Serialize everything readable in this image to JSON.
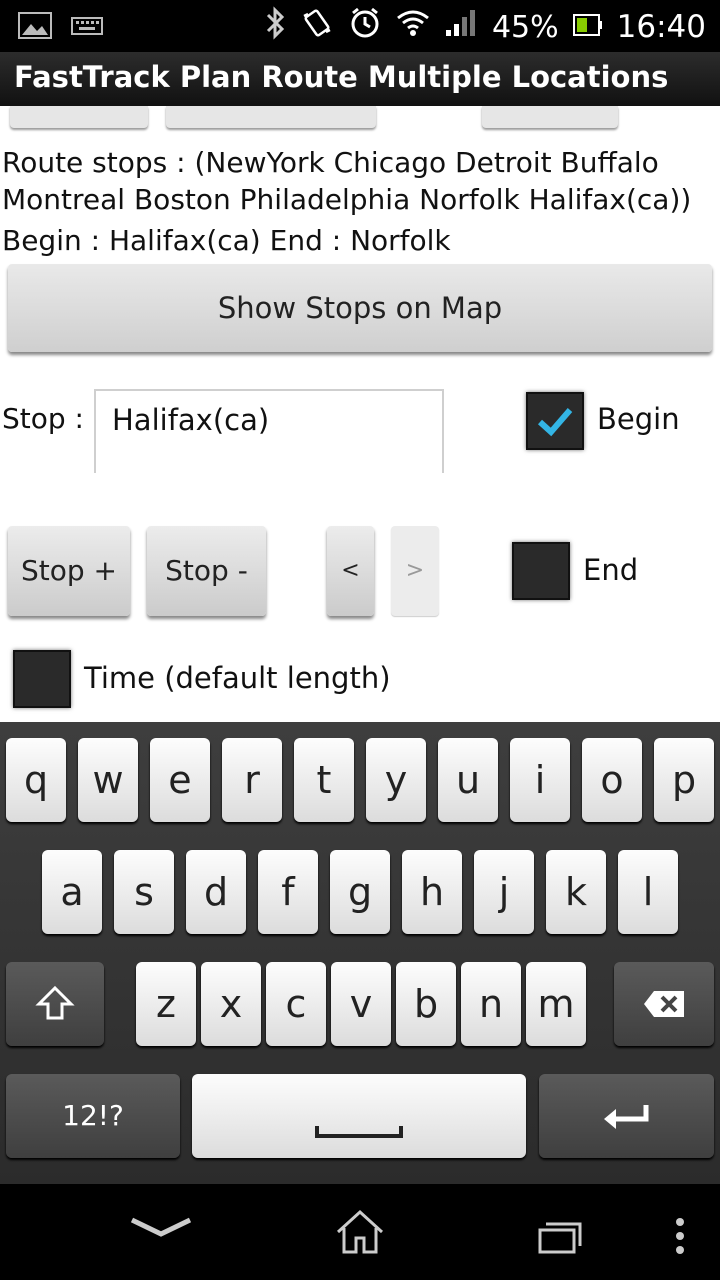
{
  "status_bar": {
    "battery": "45%",
    "time": "16:40"
  },
  "app": {
    "title": "FastTrack Plan Route Multiple Locations"
  },
  "route": {
    "stops_text": "Route stops : (NewYork Chicago Detroit Buffalo Montreal Boston Philadelphia Norfolk Halifax(ca))",
    "begin_end_text": "Begin : Halifax(ca) End : Norfolk"
  },
  "actions": {
    "show_map_label": "Show Stops on Map",
    "stop_add_label": "Stop +",
    "stop_remove_label": "Stop -",
    "prev_label": "<",
    "next_label": ">"
  },
  "stop_field": {
    "label": "Stop :",
    "value": "Halifax(ca)"
  },
  "options": {
    "begin_label": "Begin",
    "begin_checked": true,
    "end_label": "End",
    "end_checked": false,
    "time_label": "Time (default length)",
    "time_checked": false
  },
  "keyboard": {
    "row1": [
      "q",
      "w",
      "e",
      "r",
      "t",
      "y",
      "u",
      "i",
      "o",
      "p"
    ],
    "row2": [
      "a",
      "s",
      "d",
      "f",
      "g",
      "h",
      "j",
      "k",
      "l"
    ],
    "row3": [
      "z",
      "x",
      "c",
      "v",
      "b",
      "n",
      "m"
    ],
    "symbols_label": "12!?"
  },
  "colors": {
    "check_accent": "#33b5e5",
    "title_bar": "#1a1a1a"
  }
}
